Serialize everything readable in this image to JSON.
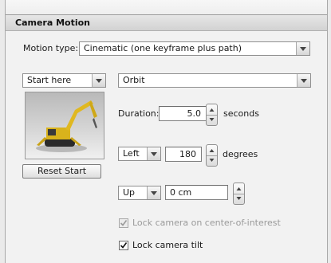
{
  "header": {
    "title": "Camera Motion"
  },
  "motion_type": {
    "label": "Motion type:",
    "selected": "Cinematic (one keyframe plus path)"
  },
  "start_dropdown": {
    "selected": "Start here"
  },
  "path_dropdown": {
    "selected": "Orbit"
  },
  "reset_button": {
    "label": "Reset Start"
  },
  "duration": {
    "label": "Duration:",
    "value": "5.0",
    "unit": "seconds"
  },
  "orbit_direction": {
    "selected": "Left",
    "value": "180",
    "unit": "degrees"
  },
  "vertical_direction": {
    "selected": "Up",
    "value": "0 cm"
  },
  "lock_coi": {
    "label": "Lock camera on center-of-interest",
    "checked": true,
    "enabled": false
  },
  "lock_tilt": {
    "label": "Lock camera tilt",
    "checked": true,
    "enabled": true
  },
  "colors": {
    "header_bg": "#d6d6d6",
    "panel_bg": "#f2f2f2",
    "machine_yellow": "#e0b820"
  },
  "icons": [
    "chevron-down-icon",
    "spin-up-icon",
    "spin-down-icon",
    "checkmark-icon"
  ]
}
